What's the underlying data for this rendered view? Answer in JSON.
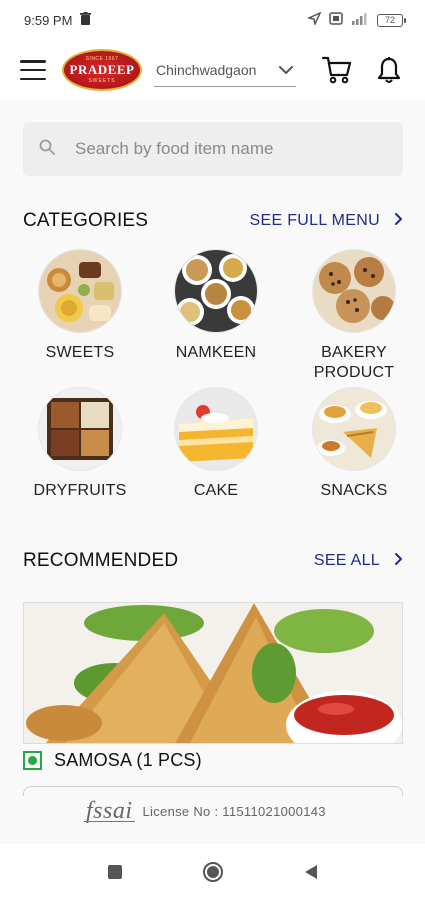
{
  "status_bar": {
    "time": "9:59 PM",
    "battery": "72"
  },
  "header": {
    "logo": {
      "top_text": "SINCE 1967",
      "brand": "PRADEEP",
      "sub_text": "SWEETS"
    },
    "location": "Chinchwadgaon",
    "icons": [
      "menu-icon",
      "cart-icon",
      "bell-icon"
    ]
  },
  "search": {
    "placeholder": "Search by food item name"
  },
  "categories": {
    "title": "CATEGORIES",
    "link_label": "SEE FULL MENU",
    "items": [
      {
        "label": "SWEETS"
      },
      {
        "label": "NAMKEEN"
      },
      {
        "label": "BAKERY\nPRODUCT"
      },
      {
        "label": "DRYFRUITS"
      },
      {
        "label": "CAKE"
      },
      {
        "label": "SNACKS"
      }
    ]
  },
  "recommended": {
    "title": "RECOMMENDED",
    "link_label": "SEE ALL",
    "item": {
      "name": "SAMOSA (1 PCS)",
      "veg": true
    }
  },
  "footer": {
    "fssai_logo": "fssai",
    "license": "License No : 11511021000143"
  },
  "colors": {
    "accent": "#1f2b8c",
    "brand_red": "#b4161b",
    "veg_green": "#28a745",
    "background": "#f9f9f9"
  }
}
